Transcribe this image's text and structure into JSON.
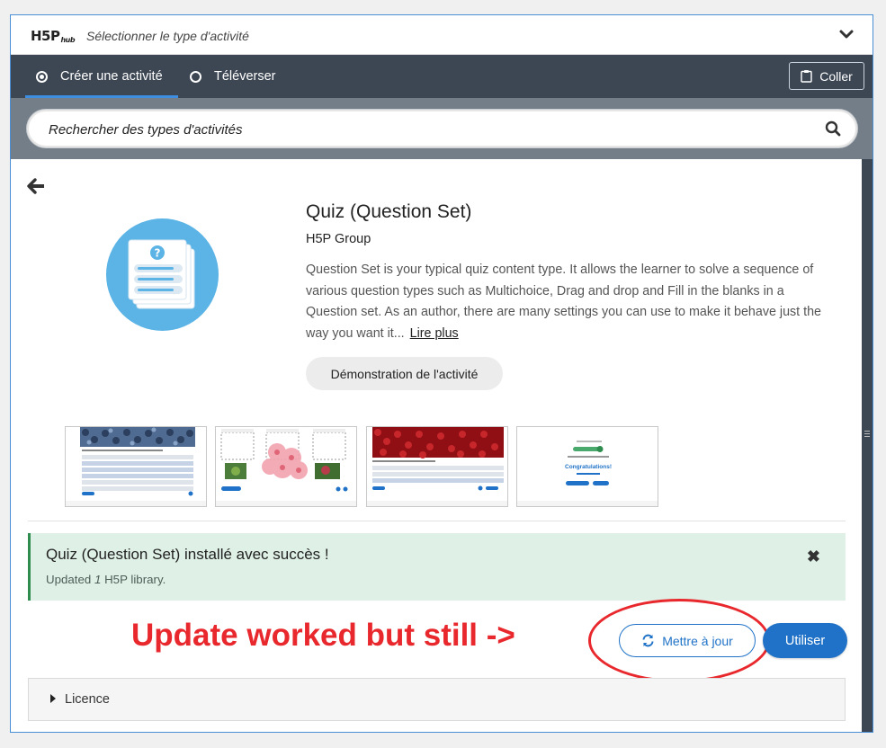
{
  "hub": {
    "logo": "H5P",
    "logo_sub": "hub",
    "title": "Sélectionner le type d'activité"
  },
  "tabs": [
    {
      "label": "Créer une activité",
      "selected": true
    },
    {
      "label": "Téléverser",
      "selected": false
    }
  ],
  "paste_label": "Coller",
  "search": {
    "placeholder": "Rechercher des types d'activités"
  },
  "content_type": {
    "title": "Quiz (Question Set)",
    "owner": "H5P Group",
    "description": "Question Set is your typical quiz content type. It allows the learner to solve a sequence of various question types such as Multichoice, Drag and drop and Fill in the blanks in a Question set. As an author, there are many settings you can use to make it behave just the way you want it...",
    "read_more": "Lire plus",
    "demo_label": "Démonstration de l'activité",
    "icon": "question-set-icon"
  },
  "screenshots": [
    {
      "name": "blueberries-quiz"
    },
    {
      "name": "drag-drop-quiz"
    },
    {
      "name": "cranberries-quiz"
    },
    {
      "name": "congratulations-summary",
      "text": "Congratulations!"
    }
  ],
  "alert": {
    "title": "Quiz (Question Set) installé avec succès !",
    "detail_prefix": "Updated ",
    "detail_count": "1",
    "detail_suffix": " H5P library.",
    "close_icon": "close-icon"
  },
  "annotation": {
    "text": "Update worked but still ->",
    "color": "#e8282c"
  },
  "actions": {
    "update_label": "Mettre à jour",
    "use_label": "Utiliser"
  },
  "licence": {
    "label": "Licence"
  },
  "colors": {
    "accent": "#1f72c7",
    "tabbar": "#3d4754",
    "success_bg": "#dff0e6",
    "annotation_red": "#e8282c"
  }
}
